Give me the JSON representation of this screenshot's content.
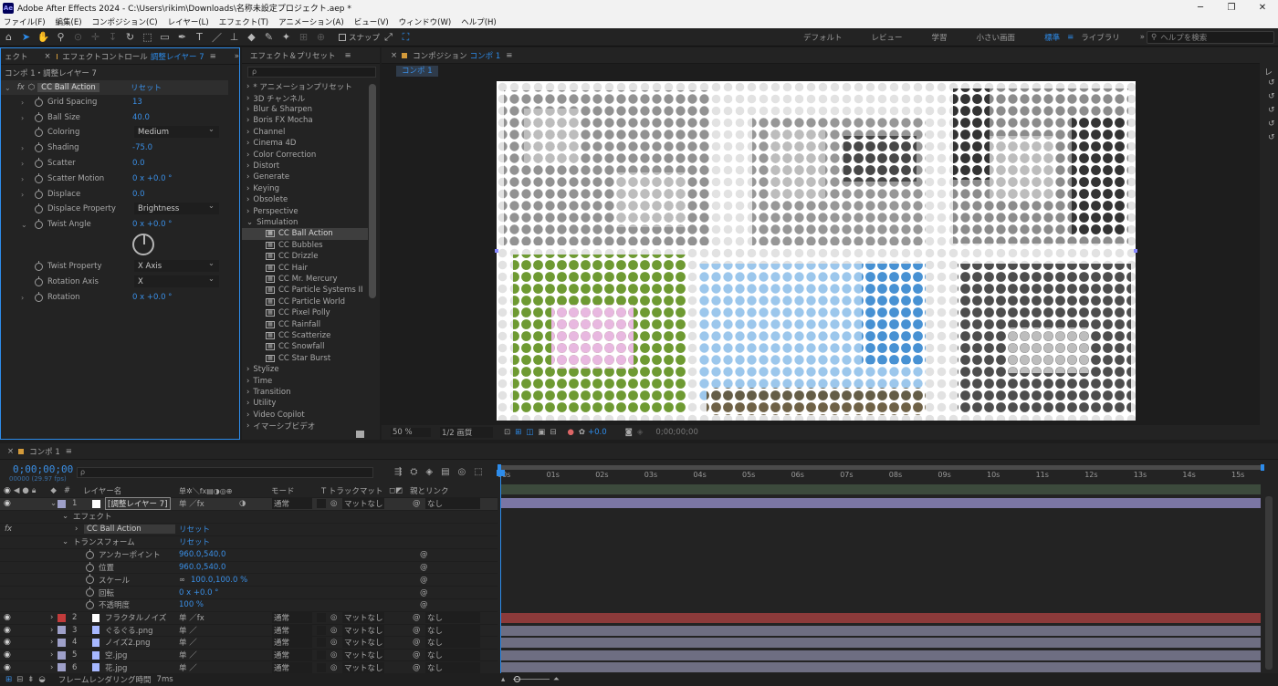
{
  "window": {
    "title": "Adobe After Effects 2024 - C:\\Users\\rikim\\Downloads\\名称未設定プロジェクト.aep *",
    "app_icon": "Ae"
  },
  "menu": [
    "ファイル(F)",
    "編集(E)",
    "コンポジション(C)",
    "レイヤー(L)",
    "エフェクト(T)",
    "アニメーション(A)",
    "ビュー(V)",
    "ウィンドウ(W)",
    "ヘルプ(H)"
  ],
  "toolbar": {
    "snap_label": "スナップ",
    "workspaces": [
      "デフォルト",
      "レビュー",
      "学習",
      "小さい画面",
      "標準",
      "ライブラリ"
    ],
    "active_workspace": "標準",
    "help_placeholder": "ヘルプを検索",
    "overflow": "»"
  },
  "effect_controls": {
    "left_stub": "ェクト",
    "tab_label": "エフェクトコントロール",
    "tab_layer": "調整レイヤー 7",
    "breadcrumb": "コンポ 1・調整レイヤー 7",
    "effect_name": "CC Ball Action",
    "reset": "リセット",
    "props": [
      {
        "name": "Grid Spacing",
        "value": "13"
      },
      {
        "name": "Ball Size",
        "value": "40.0"
      },
      {
        "name": "Coloring",
        "value": "Medium",
        "dropdown": true
      },
      {
        "name": "Shading",
        "value": "-75.0"
      },
      {
        "name": "Scatter",
        "value": "0.0"
      },
      {
        "name": "Scatter Motion",
        "value": "0 x +0.0 °"
      },
      {
        "name": "Displace",
        "value": "0.0"
      },
      {
        "name": "Displace Property",
        "value": "Brightness",
        "dropdown": true
      },
      {
        "name": "Twist Angle",
        "value": "0 x +0.0 °"
      },
      {
        "name": "Twist Property",
        "value": "X Axis",
        "dropdown": true
      },
      {
        "name": "Rotation Axis",
        "value": "X",
        "dropdown": true
      },
      {
        "name": "Rotation",
        "value": "0 x +0.0 °"
      }
    ]
  },
  "effects_presets": {
    "title": "エフェクト＆プリセット",
    "search_placeholder": "ρ",
    "categories_top": [
      "* アニメーションプリセット",
      "3D チャンネル",
      "Blur & Sharpen",
      "Boris FX Mocha",
      "Channel",
      "Cinema 4D",
      "Color Correction",
      "Distort",
      "Generate",
      "Keying",
      "Obsolete",
      "Perspective",
      "Simulation"
    ],
    "simulation_items": [
      "CC Ball Action",
      "CC Bubbles",
      "CC Drizzle",
      "CC Hair",
      "CC Mr. Mercury",
      "CC Particle Systems II",
      "CC Particle World",
      "CC Pixel Polly",
      "CC Rainfall",
      "CC Scatterize",
      "CC Snowfall",
      "CC Star Burst"
    ],
    "categories_bottom": [
      "Stylize",
      "Time",
      "Transition",
      "Utility",
      "Video Copilot",
      "イマーシブビデオ"
    ],
    "selected": "CC Ball Action"
  },
  "composition": {
    "panel_title_prefix": "コンポジション",
    "comp_name": "コンポ 1",
    "tab": "コンポ 1",
    "zoom": "50 %",
    "resolution": "1/2 画質",
    "exposure": "+0.0",
    "timecode": "0;00;00;00"
  },
  "timeline": {
    "tab": "コンポ 1",
    "timecode": "0;00;00;00",
    "fps": "00000 (29.97 fps)",
    "col_layer_name": "レイヤー名",
    "col_mode": "モード",
    "col_trackmatte": "T トラックマット",
    "col_parent": "親とリンク",
    "ruler": [
      "00s",
      "01s",
      "02s",
      "03s",
      "04s",
      "05s",
      "06s",
      "07s",
      "08s",
      "09s",
      "10s",
      "11s",
      "12s",
      "13s",
      "14s",
      "15s"
    ],
    "layer1": {
      "num": "1",
      "name": "[調整レイヤー 7]",
      "mode": "通常",
      "matte": "マットなし",
      "parent": "なし"
    },
    "effects_label": "エフェクト",
    "effect_name": "CC Ball Action",
    "reset": "リセット",
    "transform_label": "トランスフォーム",
    "transform_reset": "リセット",
    "transform": [
      {
        "name": "アンカーポイント",
        "value": "960.0,540.0"
      },
      {
        "name": "位置",
        "value": "960.0,540.0"
      },
      {
        "name": "スケール",
        "value": "100.0,100.0 %"
      },
      {
        "name": "回転",
        "value": "0 x +0.0 °"
      },
      {
        "name": "不透明度",
        "value": "100 %"
      }
    ],
    "layers": [
      {
        "num": "2",
        "name": "フラクタルノイズ",
        "color": "#c23b3b",
        "mode": "通常",
        "matte": "マットなし",
        "parent": "なし",
        "bar": "#8c3a3a"
      },
      {
        "num": "3",
        "name": "ぐるぐる.png",
        "color": "#9ea0c9",
        "mode": "通常",
        "matte": "マットなし",
        "parent": "なし",
        "bar": "#6e6e82"
      },
      {
        "num": "4",
        "name": "ノイズ2.png",
        "color": "#9ea0c9",
        "mode": "通常",
        "matte": "マットなし",
        "parent": "なし",
        "bar": "#6e6e82"
      },
      {
        "num": "5",
        "name": "空.jpg",
        "color": "#9ea0c9",
        "mode": "通常",
        "matte": "マットなし",
        "parent": "なし",
        "bar": "#6e6e82"
      },
      {
        "num": "6",
        "name": "花.jpg",
        "color": "#9ea0c9",
        "mode": "通常",
        "matte": "マットなし",
        "parent": "なし",
        "bar": "#6e6e82"
      }
    ],
    "footer": "フレームレンダリング時間",
    "render_time": "7ms"
  },
  "colors": {
    "accent": "#2d8ceb",
    "panel": "#232323",
    "layer1_bar": "#7b76a4"
  }
}
